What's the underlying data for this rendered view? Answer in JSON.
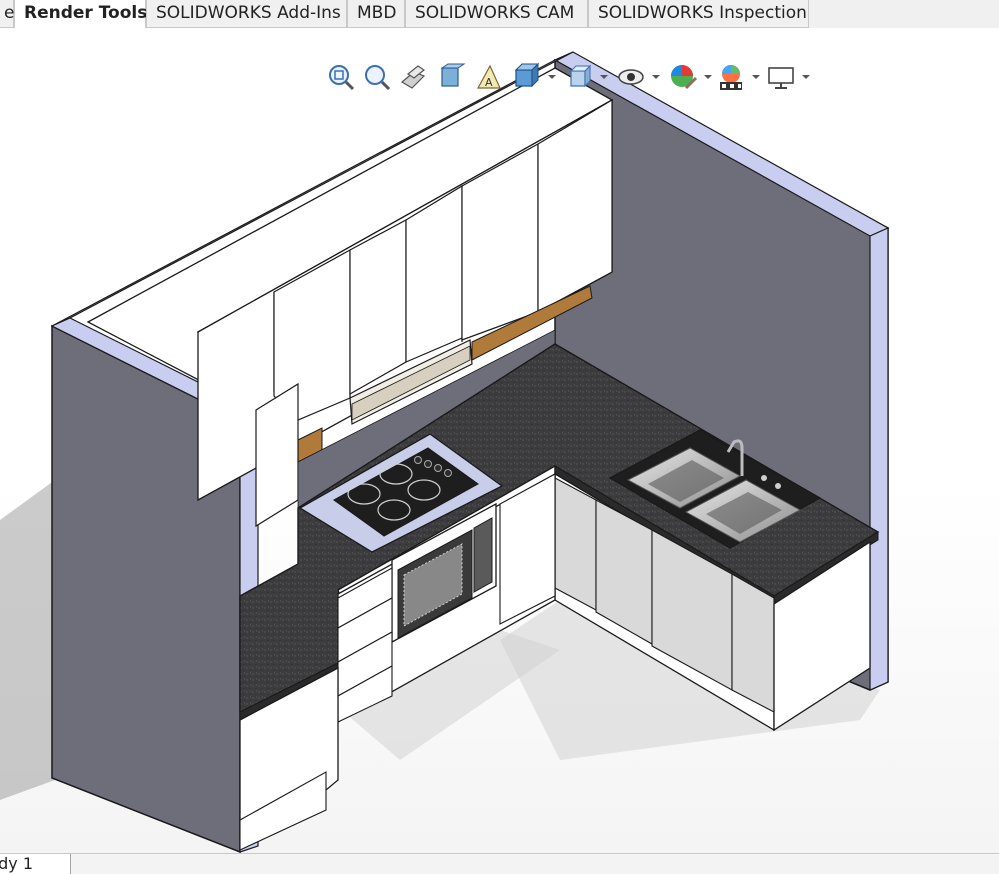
{
  "command_manager": {
    "tabs": [
      {
        "label": "e"
      },
      {
        "label": "Render Tools",
        "active": true
      },
      {
        "label": "SOLIDWORKS Add-Ins"
      },
      {
        "label": "MBD"
      },
      {
        "label": "SOLIDWORKS CAM"
      },
      {
        "label": "SOLIDWORKS Inspection"
      }
    ]
  },
  "heads_up_toolbar": {
    "icons": [
      "zoom-to-fit-icon",
      "zoom-to-area-icon",
      "previous-view-icon",
      "section-view-icon",
      "dynamic-annotation-views-icon",
      "view-orientation-icon",
      "display-style-icon",
      "hide-show-items-icon",
      "edit-appearance-icon",
      "apply-scene-icon",
      "view-settings-icon"
    ]
  },
  "bottom_tabs": {
    "study_tab": "udy 1"
  },
  "colors": {
    "wall": "#6d6e7a",
    "wall_edge": "#c9cdf0",
    "cabinet": "#ffffff",
    "countertop": "#3b3b3d",
    "active_tab_bg": "#ffffff"
  }
}
